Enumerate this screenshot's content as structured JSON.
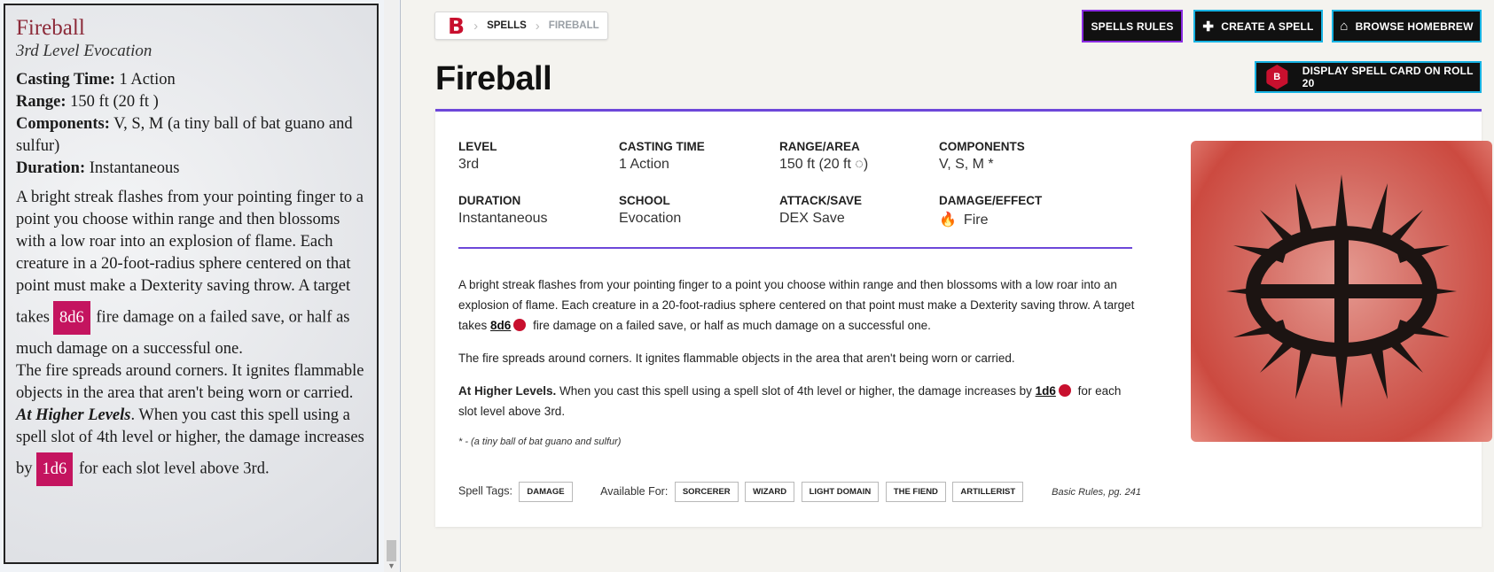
{
  "card": {
    "title": "Fireball",
    "subtitle": "3rd Level Evocation",
    "casting_time_label": "Casting Time:",
    "casting_time": "1 Action",
    "range_label": "Range:",
    "range": "150 ft (20 ft )",
    "components_label": "Components:",
    "components": "V, S, M (a tiny ball of bat guano and sulfur)",
    "duration_label": "Duration:",
    "duration": "Instantaneous",
    "body1": "A bright streak flashes from your pointing finger to a point you choose within range and then blossoms with a low roar into an explosion of flame. Each creature in a 20-foot-radius sphere centered on that point must make a Dexterity saving throw. A target takes",
    "dice1": "8d6",
    "body2": "fire damage on a failed save, or half as much damage on a successful one.",
    "body3": "The fire spreads around corners. It ignites flammable objects in the area that aren't being worn or carried.",
    "higher_label": "At Higher Levels",
    "higher1": ". When you cast this spell using a spell slot of 4th level or higher, the damage increases by",
    "dice2": "1d6",
    "higher2": "for each slot level above 3rd."
  },
  "breadcrumb": {
    "logo": "B",
    "spells": "SPELLS",
    "current": "FIREBALL"
  },
  "buttons": {
    "rules": "SPELLS RULES",
    "create": "CREATE A SPELL",
    "browse": "BROWSE HOMEBREW",
    "display": "DISPLAY SPELL CARD ON ROLL 20",
    "d20_label": "B"
  },
  "spell": {
    "name": "Fireball",
    "stats": [
      {
        "label": "LEVEL",
        "value": "3rd"
      },
      {
        "label": "CASTING TIME",
        "value": "1 Action"
      },
      {
        "label": "RANGE/AREA",
        "value": "150 ft (20 ft ◌)"
      },
      {
        "label": "COMPONENTS",
        "value": "V, S, M *"
      },
      {
        "label": "DURATION",
        "value": "Instantaneous"
      },
      {
        "label": "SCHOOL",
        "value": "Evocation"
      },
      {
        "label": "ATTACK/SAVE",
        "value": "DEX Save"
      },
      {
        "label": "DAMAGE/EFFECT",
        "value": "Fire"
      }
    ],
    "desc1a": "A bright streak flashes from your pointing finger to a point you choose within range and then blossoms with a low roar into an explosion of flame. Each creature in a 20-foot-radius sphere centered on that point must make a Dexterity saving throw. A target takes",
    "desc1_dice": "8d6",
    "desc1b": "fire damage on a failed save, or half as much damage on a successful one.",
    "desc2": "The fire spreads around corners. It ignites flammable objects in the area that aren't being worn or carried.",
    "higher_label": "At Higher Levels.",
    "desc3a": "When you cast this spell using a spell slot of 4th level or higher, the damage increases by",
    "desc3_dice": "1d6",
    "desc3b": "for each slot level above 3rd.",
    "footnote": "* - (a tiny ball of bat guano and sulfur)",
    "tags_label": "Spell Tags:",
    "tags": [
      "DAMAGE"
    ],
    "available_label": "Available For:",
    "available": [
      "SORCERER",
      "WIZARD",
      "LIGHT DOMAIN",
      "THE FIEND",
      "ARTILLERIST"
    ],
    "source": "Basic Rules, pg. 241"
  },
  "colors": {
    "accent": "#6d47d9",
    "brand_red": "#c8102e",
    "button_border": "#17b3e3",
    "dice_badge": "#c4145f"
  },
  "icons": [
    "chevron-right-icon",
    "plus-icon",
    "home-icon",
    "d20-icon",
    "fire-icon",
    "sphere-icon",
    "die-icon",
    "evocation-symbol-icon"
  ]
}
